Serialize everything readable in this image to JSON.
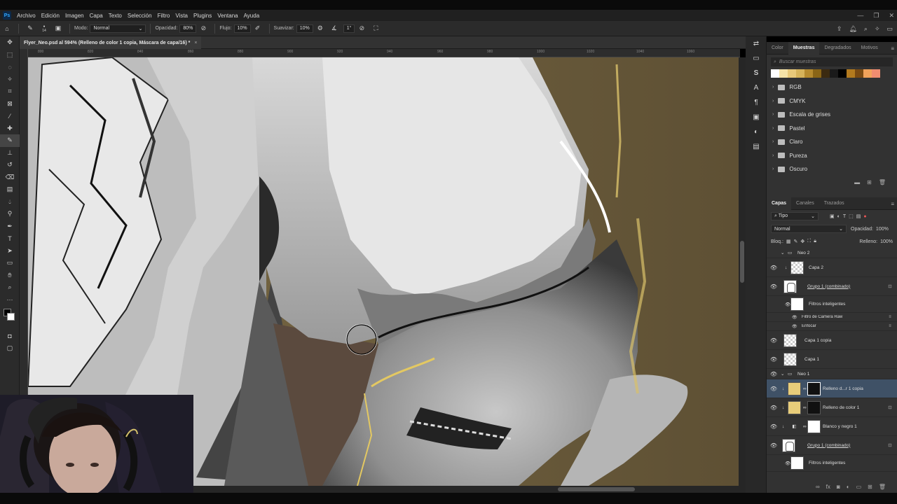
{
  "menubar": {
    "items": [
      "Archivo",
      "Edición",
      "Imagen",
      "Capa",
      "Texto",
      "Selección",
      "Filtro",
      "Vista",
      "Plugins",
      "Ventana",
      "Ayuda"
    ]
  },
  "options": {
    "mode_label": "Modo:",
    "mode_value": "Normal",
    "brush_size": "14",
    "opacity_label": "Opacidad:",
    "opacity_value": "80%",
    "flow_label": "Flujo:",
    "flow_value": "10%",
    "smoothing_label": "Suavizar:",
    "smoothing_value": "10%",
    "angle_value": "1°"
  },
  "document": {
    "tab_title": "Flyer_Neo.psd al 594% (Relleno de color 1 copia, Máscara de capa/16) *",
    "close_icon": "×"
  },
  "ruler": {
    "ticks": [
      "800",
      "820",
      "840",
      "860",
      "880",
      "900",
      "920",
      "940",
      "960",
      "980",
      "1000",
      "1020",
      "1040",
      "1060"
    ]
  },
  "swatches_panel": {
    "tabs": [
      "Color",
      "Muestras",
      "Degradados",
      "Motivos"
    ],
    "search_placeholder": "Buscar muestras",
    "swatch_colors": [
      "#ffffff",
      "#f5e3a8",
      "#e8c97a",
      "#d6b35a",
      "#b58a2e",
      "#8a6516",
      "#3b2a10",
      "#1a1a1a",
      "#000000",
      "#b37a1e",
      "#7a4a12",
      "#f0a25a",
      "#ef8c70"
    ],
    "folders": [
      "RGB",
      "CMYK",
      "Escala de grises",
      "Pastel",
      "Claro",
      "Pureza",
      "Oscuro"
    ]
  },
  "layers_panel": {
    "tabs": [
      "Capas",
      "Canales",
      "Trazados"
    ],
    "filter_label": "Tipo",
    "blend_mode": "Normal",
    "opacity_label": "Opacidad:",
    "opacity_value": "100%",
    "lock_label": "Bloq.:",
    "fill_label": "Relleno:",
    "fill_value": "100%",
    "layers": [
      {
        "name": "Neo 2",
        "kind": "group"
      },
      {
        "name": "Capa 2",
        "kind": "checker"
      },
      {
        "name": "Grupo 1 (combinado)",
        "kind": "smart"
      },
      {
        "name": "Filtros inteligentes",
        "kind": "filters"
      },
      {
        "name": "Filtro de Camera Raw",
        "kind": "filter"
      },
      {
        "name": "Enfocar",
        "kind": "filter"
      },
      {
        "name": "Capa 1 copia",
        "kind": "checker"
      },
      {
        "name": "Capa 1",
        "kind": "checker"
      },
      {
        "name": "Neo 1",
        "kind": "group"
      },
      {
        "name": "Relleno d...r 1 copia",
        "kind": "fill",
        "selected": true
      },
      {
        "name": "Relleno de color 1",
        "kind": "fill"
      },
      {
        "name": "Blanco y negro 1",
        "kind": "adjust"
      },
      {
        "name": "Grupo 1 (combinado)",
        "kind": "smart"
      },
      {
        "name": "Filtros inteligentes",
        "kind": "filters"
      }
    ]
  }
}
